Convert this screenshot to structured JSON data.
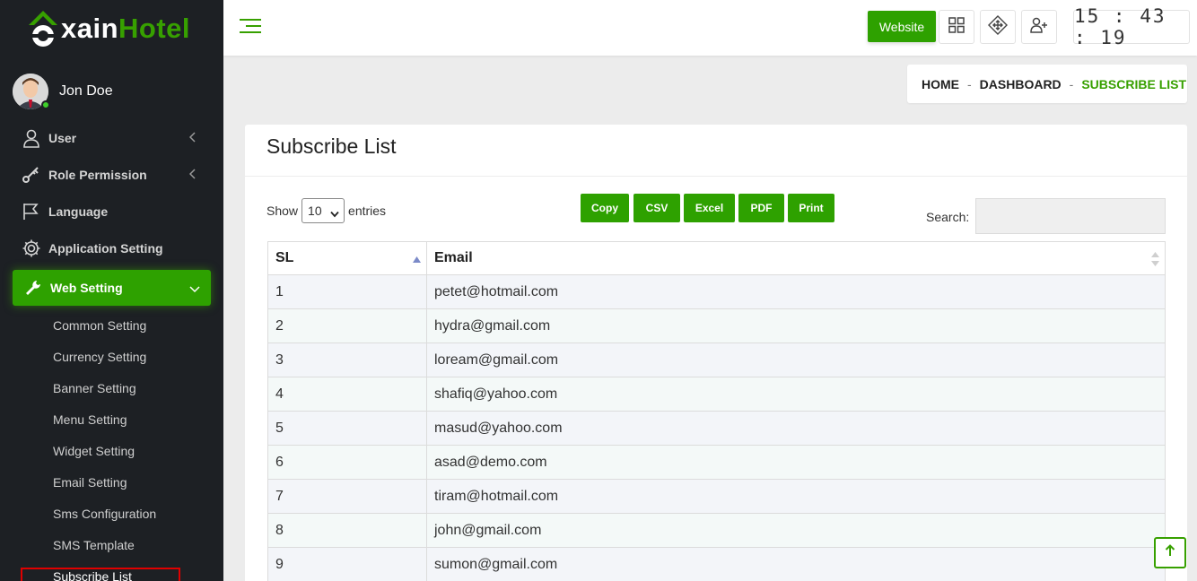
{
  "brand": {
    "part1": "xain",
    "part2": "Hotel",
    "green": "#37a000"
  },
  "user": {
    "name": "Jon Doe",
    "status_color": "#3ecf2a"
  },
  "sidebar": {
    "items": [
      {
        "label": "User",
        "icon": "user-icon"
      },
      {
        "label": "Role Permission",
        "icon": "key-icon"
      },
      {
        "label": "Language",
        "icon": "flag-icon"
      },
      {
        "label": "Application Setting",
        "icon": "gear-icon"
      }
    ],
    "active": {
      "label": "Web Setting",
      "icon": "wrench-icon"
    },
    "submenu": [
      "Common Setting",
      "Currency Setting",
      "Banner Setting",
      "Menu Setting",
      "Widget Setting",
      "Email Setting",
      "Sms Configuration",
      "SMS Template",
      "Subscribe List"
    ]
  },
  "header": {
    "website_label": "Website",
    "clock": "15 : 43 : 19"
  },
  "breadcrumb": {
    "home": "HOME",
    "dashboard": "DASHBOARD",
    "current": "SUBSCRIBE LIST",
    "sep": "-"
  },
  "page": {
    "title": "Subscribe List",
    "show_label": "Show",
    "entries_value": "10",
    "entries_label": "entries",
    "search_label": "Search:",
    "export_buttons": [
      "Copy",
      "CSV",
      "Excel",
      "PDF",
      "Print"
    ]
  },
  "table": {
    "columns": [
      "SL",
      "Email"
    ],
    "rows": [
      [
        "1",
        "petet@hotmail.com"
      ],
      [
        "2",
        "hydra@gmail.com"
      ],
      [
        "3",
        "loream@gmail.com"
      ],
      [
        "4",
        "shafiq@yahoo.com"
      ],
      [
        "5",
        "masud@yahoo.com"
      ],
      [
        "6",
        "asad@demo.com"
      ],
      [
        "7",
        "tiram@hotmail.com"
      ],
      [
        "8",
        "john@gmail.com"
      ],
      [
        "9",
        "sumon@gmail.com"
      ]
    ]
  }
}
